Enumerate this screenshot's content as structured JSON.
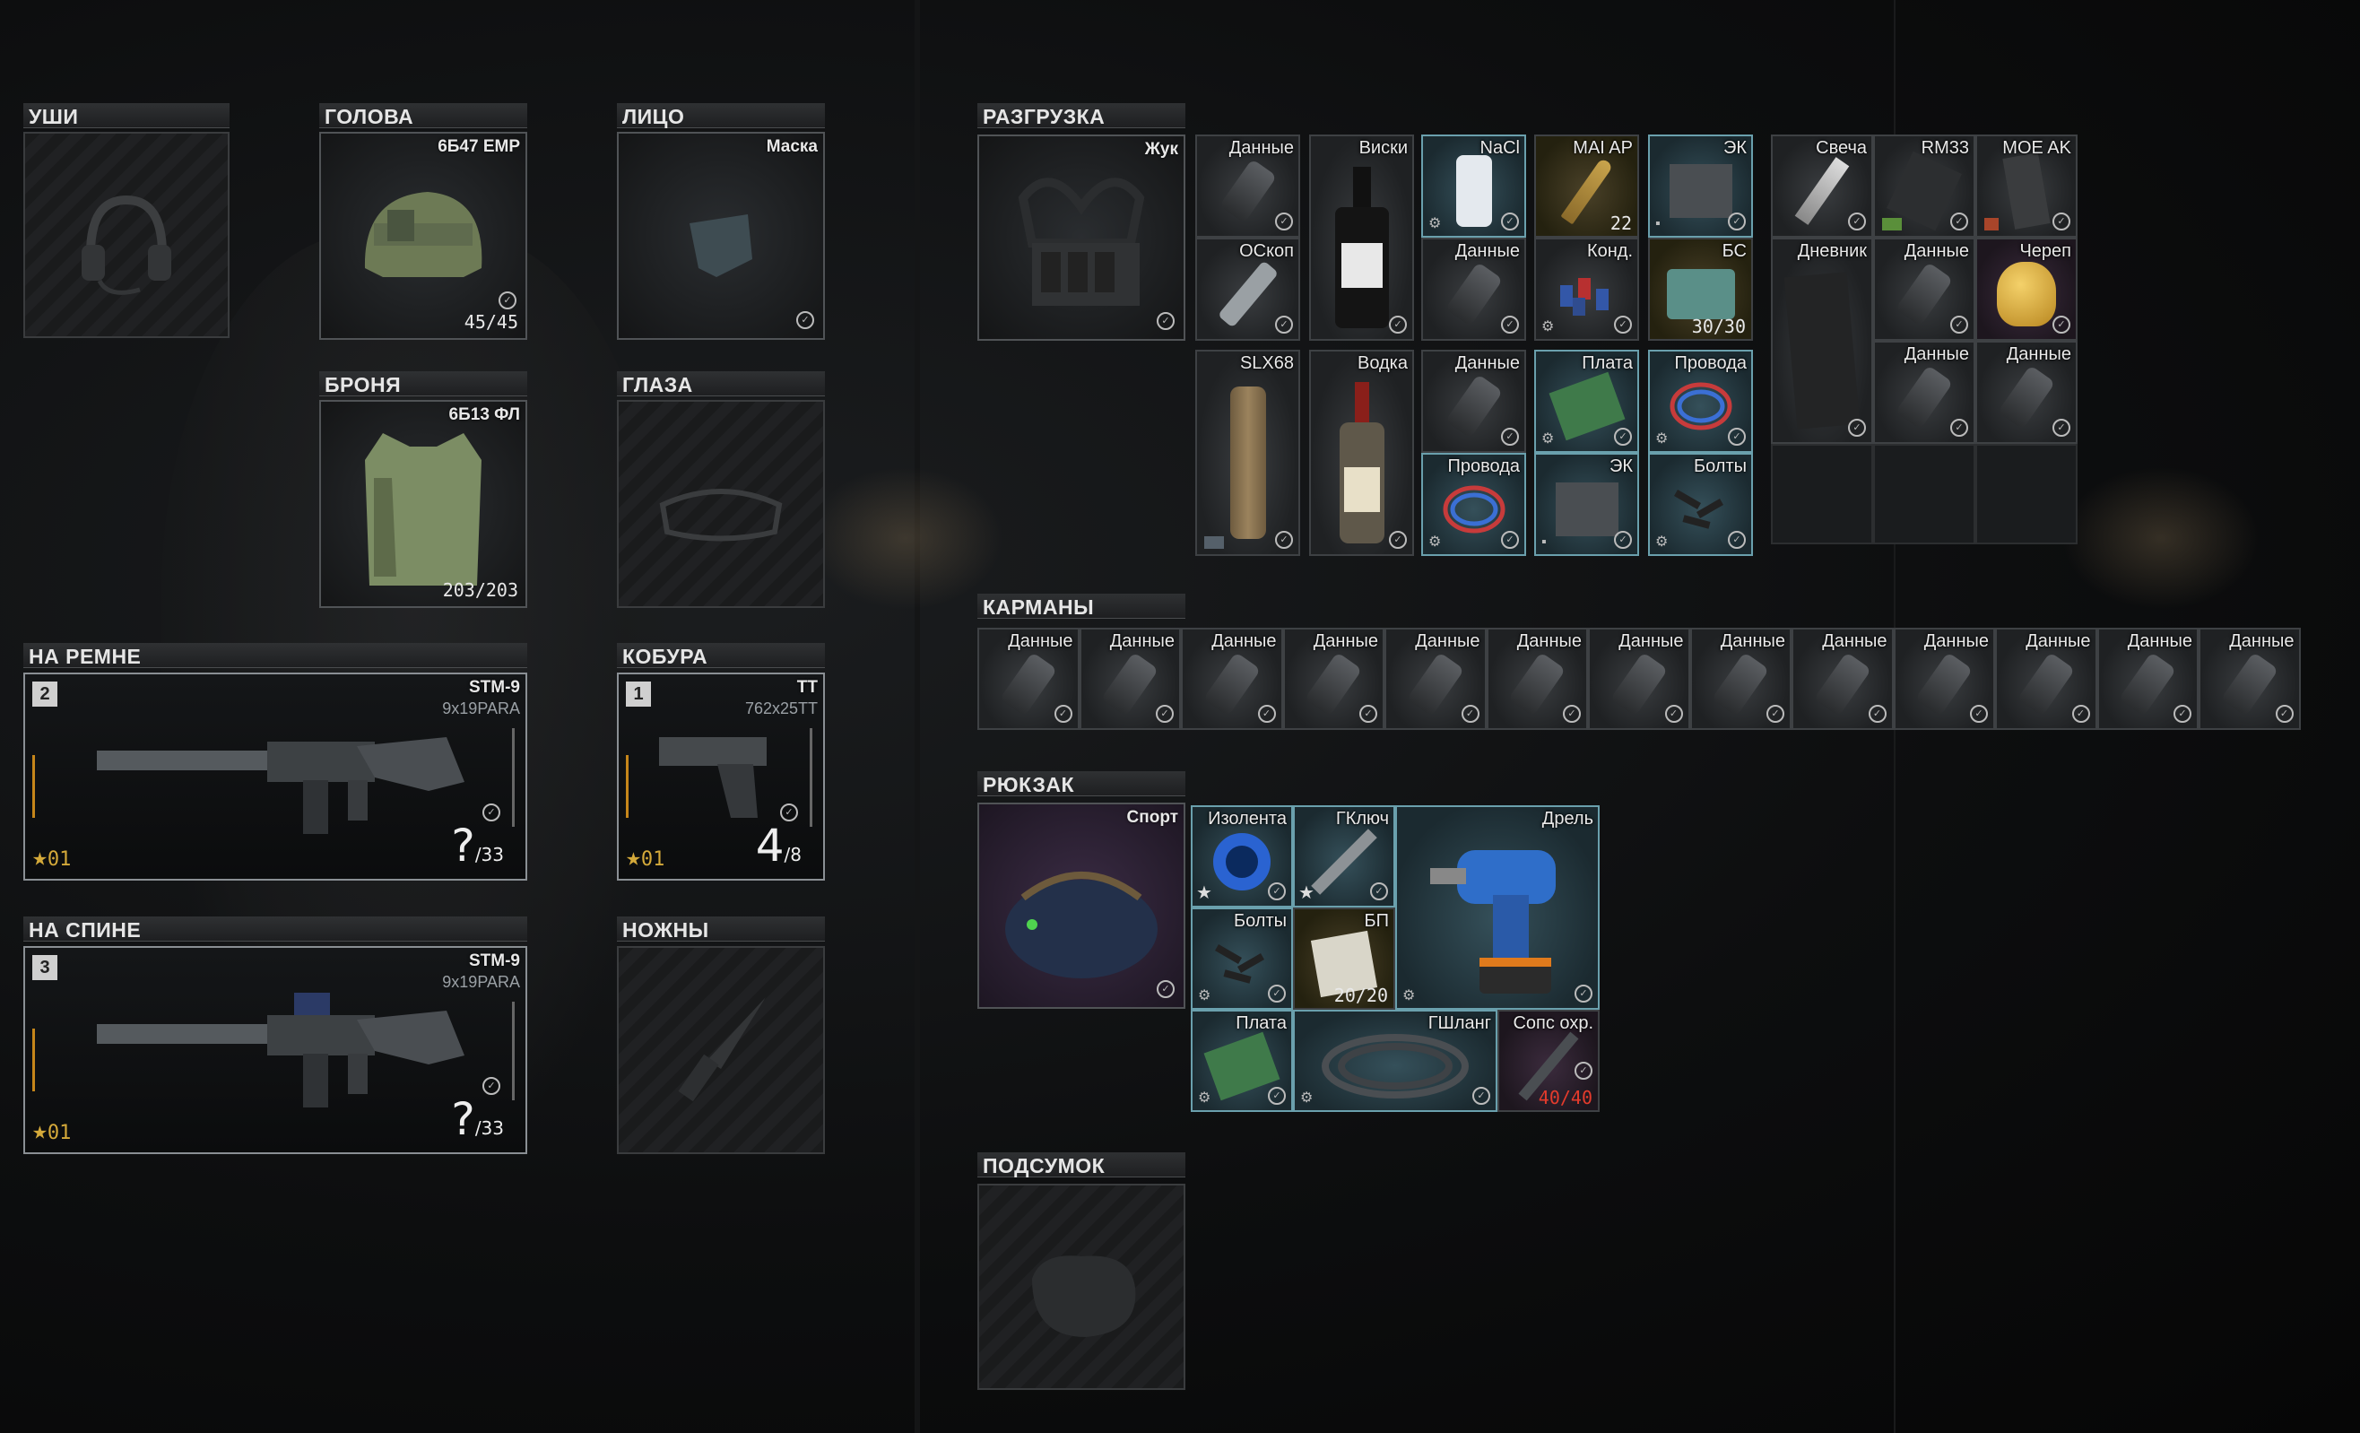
{
  "left": {
    "ears": {
      "header": "УШИ"
    },
    "head": {
      "header": "ГОЛОВА",
      "name": "6Б47 EMP",
      "durability": "45/45"
    },
    "face": {
      "header": "ЛИЦО",
      "name": "Маска"
    },
    "armor": {
      "header": "БРОНЯ",
      "name": "6Б13 ФЛ",
      "durability": "203/203"
    },
    "eyes": {
      "header": "ГЛАЗА"
    },
    "sling": {
      "header": "НА РЕМНЕ",
      "slot_num": "2",
      "name": "STM-9",
      "caliber": "9x19PARA",
      "rank": "01",
      "ammo": "?",
      "ammo_max": "/33"
    },
    "holster": {
      "header": "КОБУРА",
      "slot_num": "1",
      "name": "ТТ",
      "caliber": "762x25TT",
      "rank": "01",
      "ammo": "4",
      "ammo_max": "/8"
    },
    "back": {
      "header": "НА СПИНЕ",
      "slot_num": "3",
      "name": "STM-9",
      "caliber": "9x19PARA",
      "rank": "01",
      "ammo": "?",
      "ammo_max": "/33"
    },
    "scabbard": {
      "header": "НОЖНЫ"
    }
  },
  "rig": {
    "header": "РАЗГРУЗКА",
    "name": "Жук",
    "items": [
      {
        "name": "Данные"
      },
      {
        "name": "Виски"
      },
      {
        "name": "NaCl"
      },
      {
        "name": "MAI AP",
        "count": "22"
      },
      {
        "name": "ЭК"
      },
      {
        "name": "ОСкоп"
      },
      {
        "name": "Данные"
      },
      {
        "name": "Конд."
      },
      {
        "name": "БС",
        "count": "30/30"
      },
      {
        "name": "SLX68"
      },
      {
        "name": "Водка"
      },
      {
        "name": "Данные"
      },
      {
        "name": "Плата"
      },
      {
        "name": "Провода"
      },
      {
        "name": "Провода"
      },
      {
        "name": "ЭК"
      },
      {
        "name": "Болты"
      }
    ],
    "side_items": [
      {
        "name": "Свеча"
      },
      {
        "name": "RM33"
      },
      {
        "name": "MOE AK"
      },
      {
        "name": "Дневник"
      },
      {
        "name": "Данные"
      },
      {
        "name": "Череп"
      },
      {
        "name": "Данные"
      },
      {
        "name": "Данные"
      }
    ]
  },
  "pockets": {
    "header": "КАРМАНЫ",
    "items": [
      "Данные",
      "Данные",
      "Данные",
      "Данные",
      "Данные",
      "Данные",
      "Данные",
      "Данные",
      "Данные",
      "Данные",
      "Данные",
      "Данные",
      "Данные"
    ]
  },
  "backpack": {
    "header": "РЮКЗАК",
    "name": "Спорт",
    "items": [
      {
        "name": "Изолента"
      },
      {
        "name": "ГКлюч"
      },
      {
        "name": "Дрель"
      },
      {
        "name": "Болты"
      },
      {
        "name": "БП",
        "count": "20/20"
      },
      {
        "name": "Плата"
      },
      {
        "name": "ГШланг"
      },
      {
        "name": "Сопс охр.",
        "count": "40/40"
      }
    ]
  },
  "pouch": {
    "header": "ПОДСУМОК"
  },
  "colors": {
    "accent_found": "#5f8f9a",
    "rank_gold": "#d4a93a",
    "count_red": "#e43b2c"
  }
}
